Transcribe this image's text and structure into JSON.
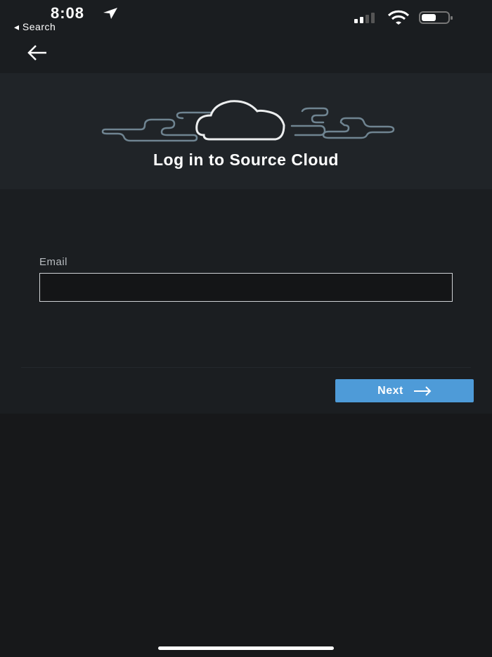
{
  "status_bar": {
    "time": "8:08",
    "back_app": "◂ Search"
  },
  "header": {
    "title": "Log in to Source Cloud"
  },
  "form": {
    "email_label": "Email",
    "email_value": "",
    "next_label": "Next"
  }
}
